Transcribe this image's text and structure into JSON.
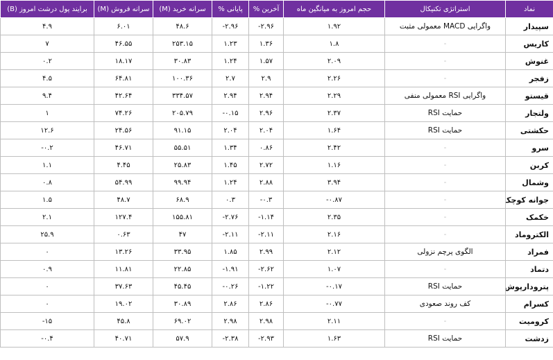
{
  "columns": {
    "symbol": "نماد",
    "strategy": "استراتژی تکنیکال",
    "volume": "حجم امروز به میانگین ماه",
    "last": "آخرین %",
    "final": "پایانی %",
    "buy_per_capita": "سرانه خرید (M)",
    "sell_per_capita": "سرانه فروش (M)",
    "net_money": "برایند پول درشت امروز (B)"
  },
  "rows": [
    {
      "symbol": "سپیدار",
      "strategy": "واگرایی MACD معمولی مثبت",
      "volume": "۱.۹۲",
      "last": "-۲.۹۶",
      "final": "-۲.۹۶",
      "buy": "۴۸.۶",
      "sell": "۶.۰۱",
      "net": "۴.۹"
    },
    {
      "symbol": "کاریس",
      "strategy": "-",
      "volume": "۱.۸",
      "last": "۱.۳۶",
      "final": "۱.۲۳",
      "buy": "۲۵۳.۱۵",
      "sell": "۴۶.۵۵",
      "net": "۷"
    },
    {
      "symbol": "غنوش",
      "strategy": "-",
      "volume": "۲.۰۹",
      "last": "۱.۵۷",
      "final": "۱.۲۴",
      "buy": "۳۰.۸۳",
      "sell": "۱۸.۱۷",
      "net": "۰.۲"
    },
    {
      "symbol": "زفجر",
      "strategy": "-",
      "volume": "۲.۲۶",
      "last": "۲.۹",
      "final": "۲.۷",
      "buy": "۱۰۰.۳۶",
      "sell": "۶۴.۸۱",
      "net": "۴.۵"
    },
    {
      "symbol": "قیستو",
      "strategy": "واگرایی RSI معمولی منفی",
      "volume": "۲.۲۹",
      "last": "۲.۹۴",
      "final": "۲.۹۴",
      "buy": "۳۳۴.۵۷",
      "sell": "۴۲.۶۴",
      "net": "۹.۴"
    },
    {
      "symbol": "ولتجار",
      "strategy": "حمایت RSI",
      "volume": "۲.۳۷",
      "last": "۲.۹۶",
      "final": "-۰.۱۵",
      "buy": "۲۰۵.۷۹",
      "sell": "۷۴.۲۶",
      "net": "۱"
    },
    {
      "symbol": "حکشتی",
      "strategy": "حمایت RSI",
      "volume": "۱.۶۴",
      "last": "۲.۰۴",
      "final": "۲.۰۴",
      "buy": "۹۱.۱۵",
      "sell": "۲۴.۵۶",
      "net": "۱۲.۶"
    },
    {
      "symbol": "سرو",
      "strategy": "-",
      "volume": "۲.۴۲",
      "last": "۰.۸۶",
      "final": "۱.۳۴",
      "buy": "۵۵.۵۱",
      "sell": "۴۶.۷۱",
      "net": "-۰.۲"
    },
    {
      "symbol": "کربن",
      "strategy": "-",
      "volume": "۱.۱۶",
      "last": "۲.۷۲",
      "final": "۱.۴۵",
      "buy": "۲۵.۸۳",
      "sell": "۴.۴۵",
      "net": "۱.۱"
    },
    {
      "symbol": "وشمال",
      "strategy": "-",
      "volume": "۳.۹۴",
      "last": "۲.۸۸",
      "final": "۱.۲۴",
      "buy": "۹۹.۹۴",
      "sell": "۵۴.۹۹",
      "net": "۰.۸"
    },
    {
      "symbol": "جوانه کوچک",
      "strategy": "-",
      "volume": "-۰.۸۷",
      "last": "-۰.۳",
      "final": "۰.۳",
      "buy": "۶۸.۹",
      "sell": "۴۸.۷",
      "net": "۱.۵"
    },
    {
      "symbol": "خکمک",
      "strategy": "-",
      "volume": "۲.۳۵",
      "last": "-۱.۱۴",
      "final": "-۲.۷۶",
      "buy": "۱۵۵.۸۱",
      "sell": "۱۲۷.۴",
      "net": "۲.۱"
    },
    {
      "symbol": "الکتروماد",
      "strategy": "-",
      "volume": "۲.۱۶",
      "last": "-۲.۱۱",
      "final": "-۲.۱۱",
      "buy": "۴۷",
      "sell": "۰.۶۳",
      "net": "۲۵.۹"
    },
    {
      "symbol": "فمراد",
      "strategy": "الگوی پرچم نزولی",
      "volume": "۲.۱۲",
      "last": "۲.۹۹",
      "final": "۱.۸۵",
      "buy": "۳۳.۹۵",
      "sell": "۱۳.۲۶",
      "net": "۰"
    },
    {
      "symbol": "دتماد",
      "strategy": "-",
      "volume": "۱.۰۷",
      "last": "-۲.۶۲",
      "final": "-۱.۹۱",
      "buy": "۲۲.۸۵",
      "sell": "۱۱.۸۱",
      "net": "۰.۹"
    },
    {
      "symbol": "پترودارپوش",
      "strategy": "حمایت RSI",
      "volume": "-۰.۱۷",
      "last": "-۱.۲۲",
      "final": "-۰.۲۶",
      "buy": "۴۵.۴۵",
      "sell": "۳۷.۶۳",
      "net": "۰"
    },
    {
      "symbol": "کسرام",
      "strategy": "کف روند صعودی",
      "volume": "-۰.۷۷",
      "last": "۲.۸۶",
      "final": "۲.۸۶",
      "buy": "۳۰.۸۹",
      "sell": "۱۹.۰۲",
      "net": "۰"
    },
    {
      "symbol": "کرومیت",
      "strategy": "-",
      "volume": "۲.۱۱",
      "last": "۲.۹۸",
      "final": "۲.۹۸",
      "buy": "۶۹.۰۲",
      "sell": "۴۵.۸",
      "net": "-۱۵"
    },
    {
      "symbol": "زدشت",
      "strategy": "حمایت RSI",
      "volume": "۱.۶۳",
      "last": "-۲.۹۳",
      "final": "-۲.۳۸",
      "buy": "۵۷.۹",
      "sell": "۴۰.۷۱",
      "net": "-۰.۴"
    }
  ]
}
